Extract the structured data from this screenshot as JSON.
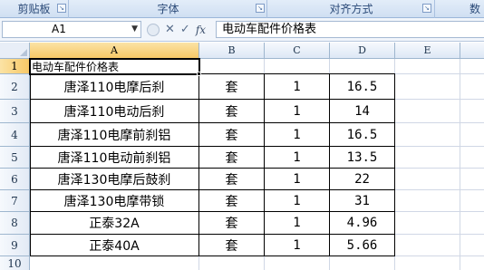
{
  "ribbon": {
    "groups": [
      {
        "label": "剪贴板"
      },
      {
        "label": "字体"
      },
      {
        "label": "对齐方式"
      },
      {
        "label": "数"
      }
    ]
  },
  "formula_bar": {
    "name_box": "A1",
    "fx": "fx",
    "content": "电动车配件价格表"
  },
  "columns": [
    "A",
    "B",
    "C",
    "D",
    "E"
  ],
  "rows": [
    "1",
    "2",
    "3",
    "4",
    "5",
    "6",
    "7",
    "8",
    "9",
    "10"
  ],
  "sheet": {
    "title": "电动车配件价格表",
    "items": [
      {
        "name": "唐泽110电摩后刹",
        "unit": "套",
        "qty": "1",
        "price": "16.5"
      },
      {
        "name": "唐泽110电动后刹",
        "unit": "套",
        "qty": "1",
        "price": "14"
      },
      {
        "name": "唐泽110电摩前刹铝",
        "unit": "套",
        "qty": "1",
        "price": "16.5"
      },
      {
        "name": "唐泽110电动前刹铝",
        "unit": "套",
        "qty": "1",
        "price": "13.5"
      },
      {
        "name": "唐泽130电摩后鼓刹",
        "unit": "套",
        "qty": "1",
        "price": "22"
      },
      {
        "name": "唐泽130电摩带锁",
        "unit": "套",
        "qty": "1",
        "price": "31"
      },
      {
        "name": "正泰32A",
        "unit": "套",
        "qty": "1",
        "price": "4.96"
      },
      {
        "name": "正泰40A",
        "unit": "套",
        "qty": "1",
        "price": "5.66"
      }
    ]
  }
}
